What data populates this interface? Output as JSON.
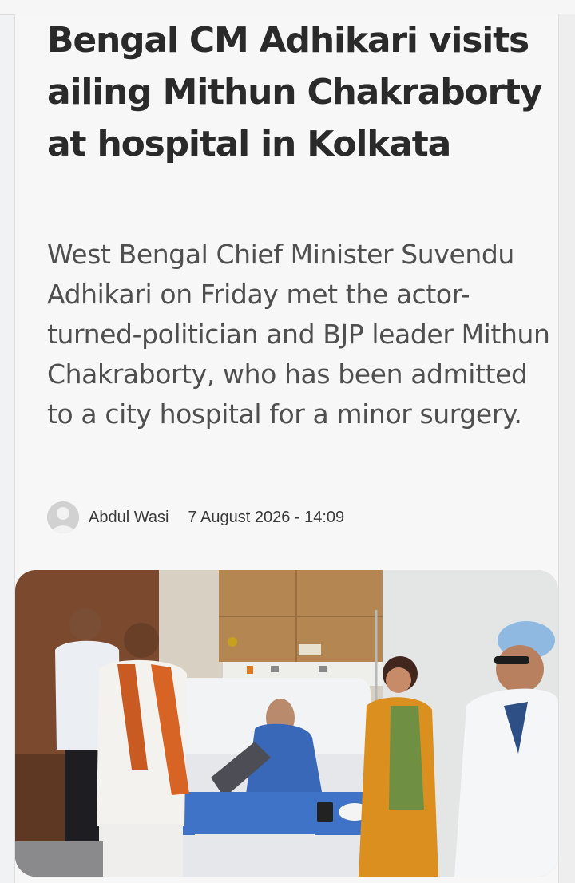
{
  "article": {
    "headline": "Bengal CM Adhikari visits ailing Mithun Chakraborty at hospital in Kolkata",
    "summary": "West Bengal Chief Minister Suvendu Adhikari on Friday met the actor-turned-politician and BJP leader Mithun Chakraborty, who has been admitted to a city hospital for a minor surgery.",
    "author": "Abdul Wasi",
    "timestamp": "7 August 2026 - 14:09"
  },
  "icons": {
    "avatar": "user-avatar-placeholder-icon"
  },
  "colors": {
    "headline": "#2a2a2a",
    "summary": "#4f4f4f",
    "background": "#f7f7f7"
  }
}
